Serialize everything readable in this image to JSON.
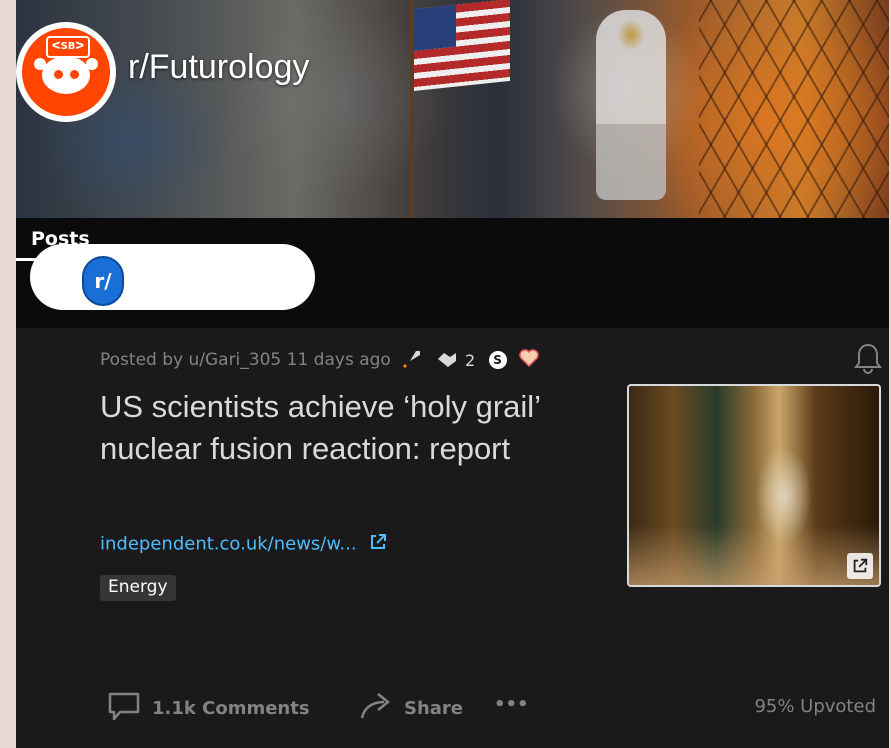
{
  "subreddit": {
    "name": "r/Futurology",
    "avatar_label": "ᐸSBᐳ"
  },
  "tabs": [
    {
      "label": "Posts"
    }
  ],
  "search": {
    "r_icon_label": "r/"
  },
  "post": {
    "meta_text": "Posted by u/Gari_305 11 days ago",
    "award_count": "2",
    "coin_label": "S",
    "title": "US scientists achieve ‘holy grail’ nuclear fusion reaction: report",
    "link_text": "independent.co.uk/news/w...",
    "flair": "Energy",
    "comments_label": "1.1k Comments",
    "share_label": "Share",
    "more_label": "•••",
    "upvoted_label": "95% Upvoted"
  },
  "colors": {
    "brand_orange": "#ff4500",
    "link_blue": "#4fbcff",
    "card_bg": "#1a1a1b",
    "muted_text": "#818384"
  }
}
